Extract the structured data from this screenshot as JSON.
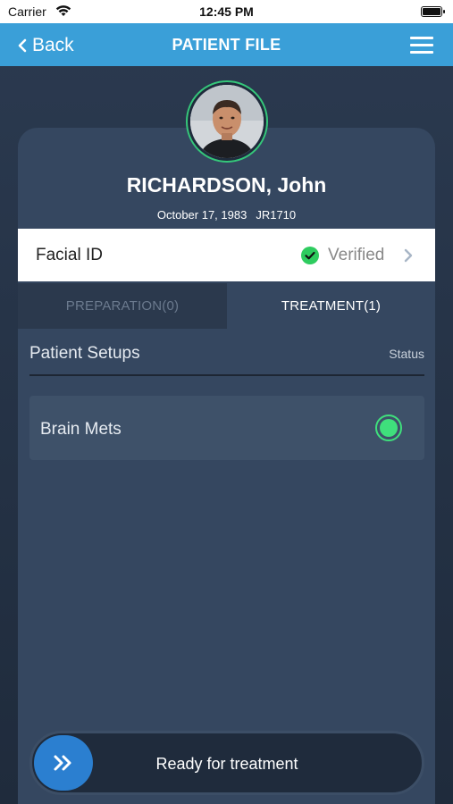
{
  "status_bar": {
    "carrier": "Carrier",
    "time": "12:45 PM"
  },
  "nav": {
    "back_label": "Back",
    "title": "PATIENT FILE"
  },
  "patient": {
    "name": "RICHARDSON, John",
    "dob": "October 17, 1983",
    "id": "JR1710"
  },
  "facial_id": {
    "label": "Facial ID",
    "status": "Verified",
    "status_color": "#2ecc5f"
  },
  "tabs": [
    {
      "label": "PREPARATION(0)",
      "active": false
    },
    {
      "label": "TREATMENT(1)",
      "active": true
    }
  ],
  "setups": {
    "title": "Patient Setups",
    "status_label": "Status",
    "items": [
      {
        "name": "Brain Mets",
        "status_color": "#3fe07c"
      }
    ]
  },
  "slider": {
    "label": "Ready for treatment",
    "accent": "#2b7fd0"
  },
  "colors": {
    "nav_blue": "#3a9fd8",
    "card": "#354760",
    "background": "#24324a"
  }
}
